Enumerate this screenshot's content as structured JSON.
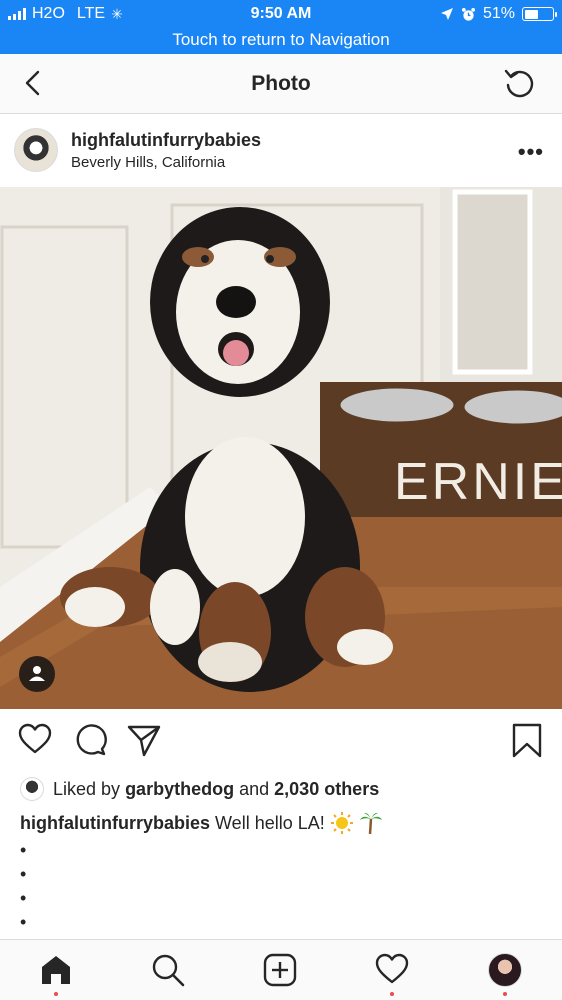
{
  "status_bar": {
    "carrier": "H2O",
    "network": "LTE",
    "time": "9:50 AM",
    "battery": "51%",
    "battery_level": 0.51,
    "return_text": "Touch to return to Navigation"
  },
  "header": {
    "title": "Photo"
  },
  "post": {
    "username": "highfalutinfurrybabies",
    "location": "Beverly Hills, California",
    "photo_sign": "ERNIE",
    "liked_prefix": "Liked by",
    "liked_user": "garbythedog",
    "liked_and": "and",
    "liked_count": "2,030 others",
    "caption_user": "highfalutinfurrybabies",
    "caption_text": "Well hello LA!",
    "bullets": [
      "•",
      "•",
      "•",
      "•"
    ]
  },
  "colors": {
    "status_blue": "#1a86f5",
    "text": "#262626",
    "notification_red": "#ed4956"
  },
  "icons": [
    "back-arrow-icon",
    "refresh-icon",
    "more-icon",
    "heart-icon",
    "comment-icon",
    "share-icon",
    "bookmark-icon",
    "home-icon",
    "search-icon",
    "add-post-icon",
    "activity-icon",
    "profile-avatar"
  ]
}
